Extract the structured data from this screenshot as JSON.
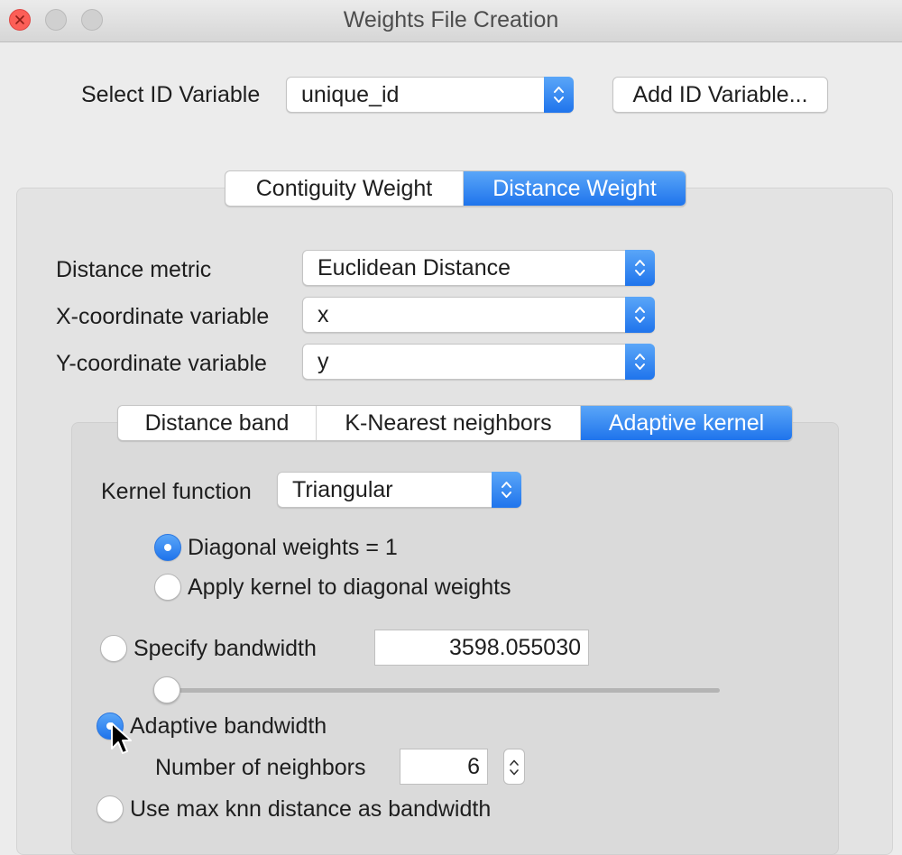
{
  "window": {
    "title": "Weights File Creation"
  },
  "id_variable": {
    "label": "Select ID Variable",
    "value": "unique_id",
    "add_button": "Add ID Variable..."
  },
  "weight_tabs": [
    {
      "label": "Contiguity Weight",
      "active": false
    },
    {
      "label": "Distance Weight",
      "active": true
    }
  ],
  "distance": {
    "metric_label": "Distance metric",
    "metric_value": "Euclidean Distance",
    "x_label": "X-coordinate variable",
    "x_value": "x",
    "y_label": "Y-coordinate variable",
    "y_value": "y"
  },
  "method_tabs": [
    {
      "label": "Distance band",
      "active": false
    },
    {
      "label": "K-Nearest neighbors",
      "active": false
    },
    {
      "label": "Adaptive kernel",
      "active": true
    }
  ],
  "kernel": {
    "function_label": "Kernel function",
    "function_value": "Triangular",
    "diagonal_options": [
      {
        "label": "Diagonal weights = 1",
        "selected": true
      },
      {
        "label": "Apply kernel to diagonal weights",
        "selected": false
      }
    ],
    "bandwidth_options": [
      {
        "label": "Specify bandwidth",
        "selected": false
      },
      {
        "label": "Adaptive bandwidth",
        "selected": true
      },
      {
        "label": "Use max knn distance as bandwidth",
        "selected": false
      }
    ],
    "bandwidth_value": "3598.055030",
    "slider_level": 0,
    "neighbors_label": "Number of neighbors",
    "neighbors_value": "6"
  },
  "colors": {
    "accent": "#2a7cf0",
    "close": "#fc5f57",
    "background": "#ececec"
  }
}
